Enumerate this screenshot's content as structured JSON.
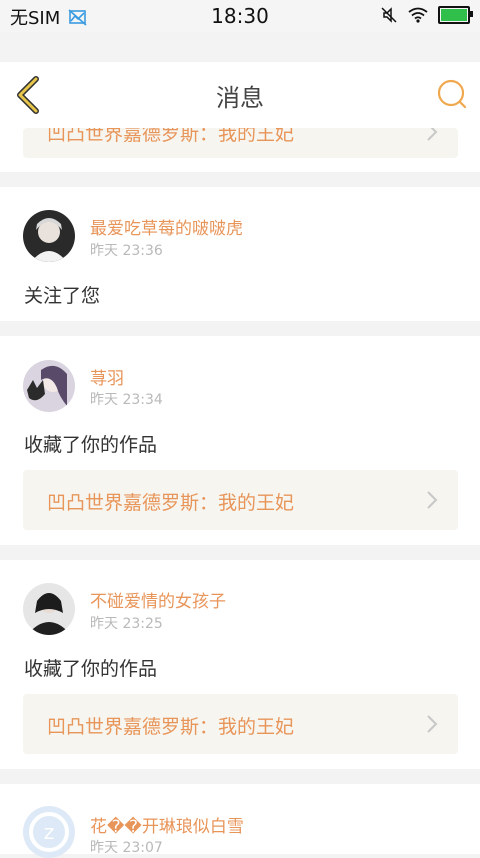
{
  "status_bar": {
    "carrier": "无SIM",
    "time": "18:30"
  },
  "nav": {
    "title": "消息",
    "back_icon": "back-chevron-icon",
    "search_icon": "search-icon",
    "accent_color": "#e8c64a"
  },
  "notifications": [
    {
      "work_title": "凹凸世界嘉德罗斯：我的王妃"
    },
    {
      "username": "最爱吃草莓的啵啵虎",
      "time": "昨天 23:36",
      "action": "关注了您"
    },
    {
      "username": "荨羽",
      "time": "昨天 23:34",
      "action": "收藏了你的作品",
      "work_title": "凹凸世界嘉德罗斯：我的王妃"
    },
    {
      "username": "不碰爱情的女孩子",
      "time": "昨天 23:25",
      "action": "收藏了你的作品",
      "work_title": "凹凸世界嘉德罗斯：我的王妃"
    },
    {
      "username": "花��开琳琅似白雪",
      "time": "昨天 23:07"
    }
  ],
  "colors": {
    "username": "#e8955a",
    "timestamp": "#b9b9b9",
    "work_bg": "#f6f5ef",
    "page_bg": "#f3f3f3"
  }
}
